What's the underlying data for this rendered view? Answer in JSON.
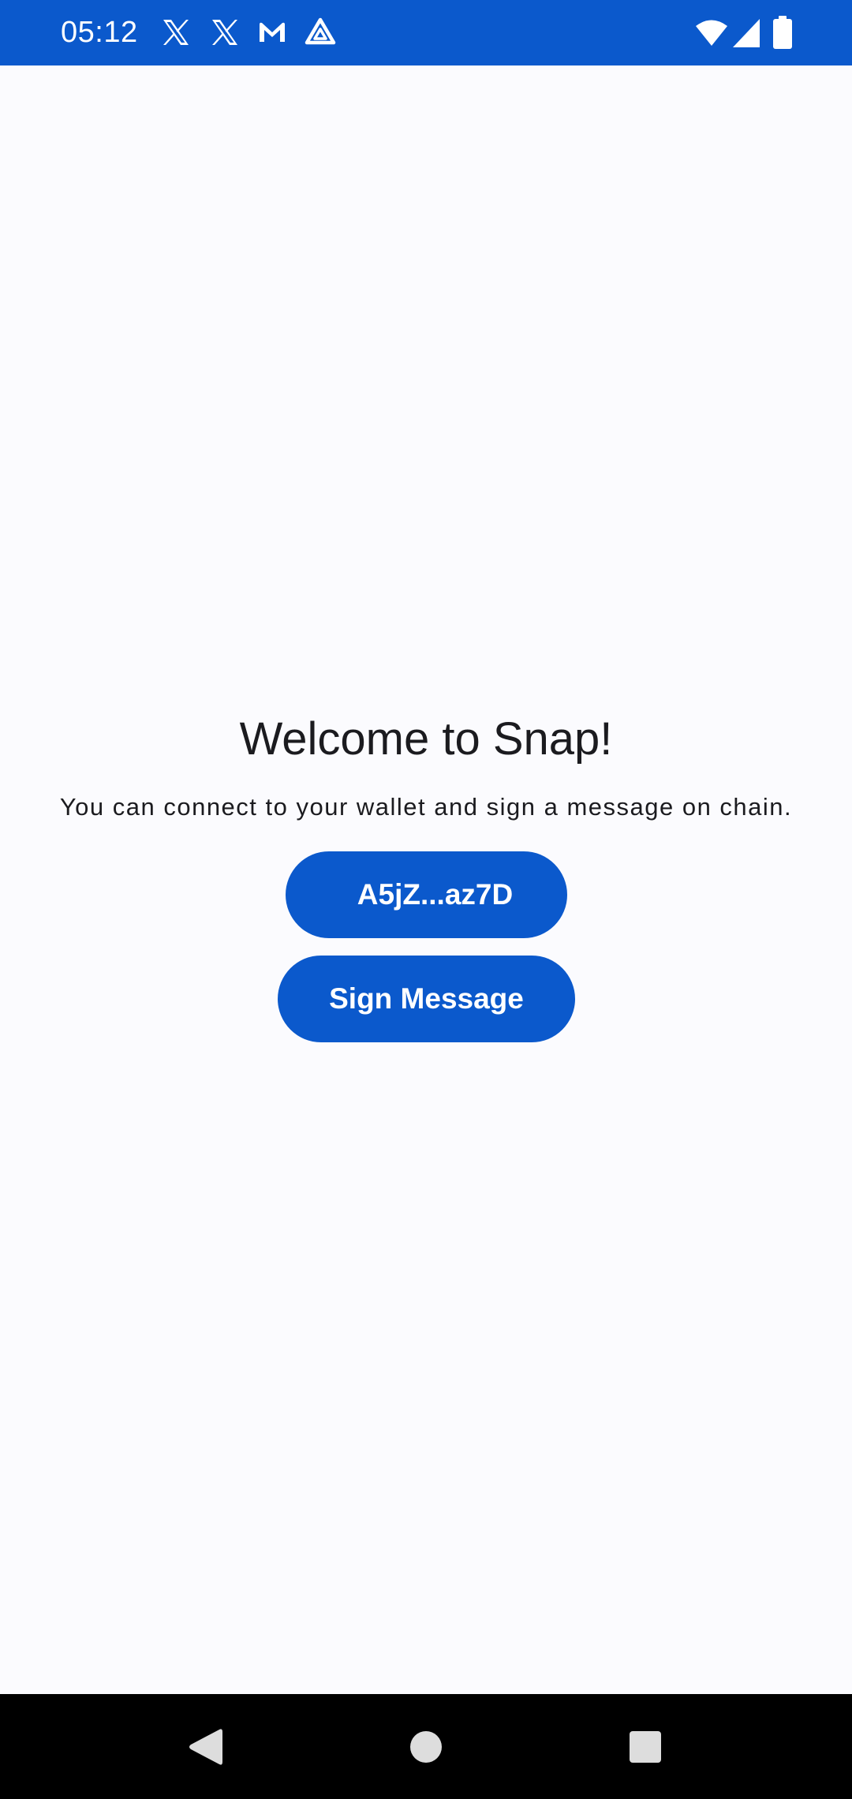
{
  "status_bar": {
    "time": "05:12",
    "notification_icons": [
      "x-icon",
      "x-icon",
      "gmail-icon",
      "drive-icon"
    ],
    "system_icons": [
      "wifi-icon",
      "cellular-signal-icon",
      "battery-icon"
    ],
    "background_color": "#0b59cc"
  },
  "main": {
    "title": "Welcome to Snap!",
    "subtitle": "You can connect to your wallet and sign a message on chain.",
    "wallet_button_label": "A5jZ...az7D",
    "sign_button_label": "Sign Message",
    "accent_color": "#0b59cc"
  },
  "nav_bar": {
    "buttons": [
      "back-icon",
      "home-icon",
      "recents-icon"
    ]
  }
}
